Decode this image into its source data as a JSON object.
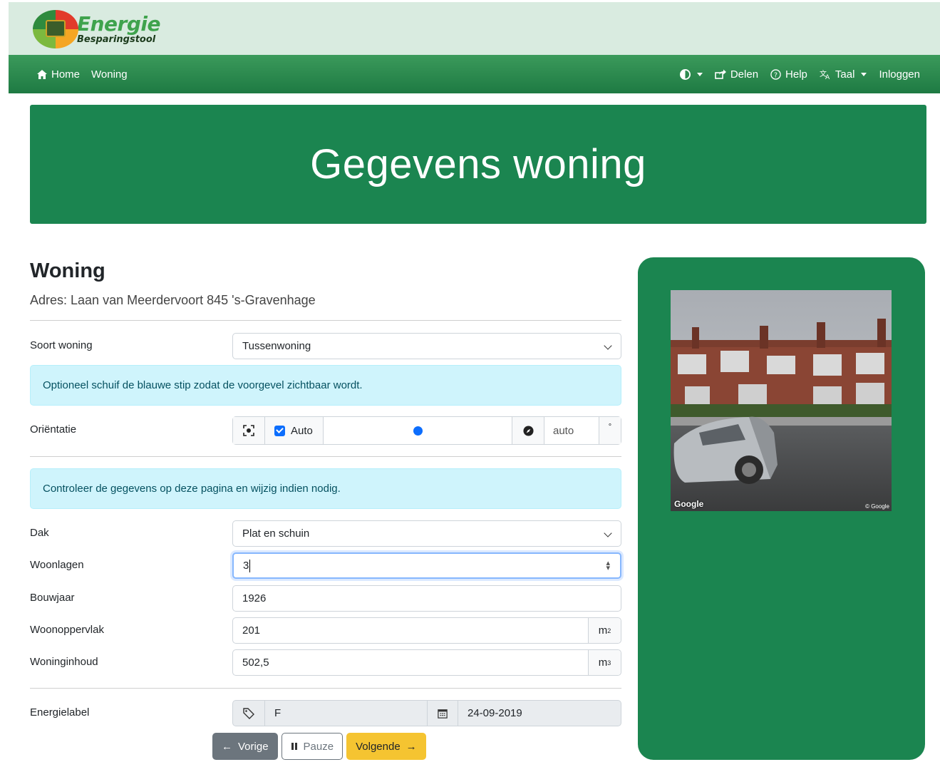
{
  "header": {
    "logo_word1": "Energie",
    "logo_word2": "Besparingstool"
  },
  "nav": {
    "home": "Home",
    "woning": "Woning",
    "theme": "",
    "share": "Delen",
    "help": "Help",
    "language": "Taal",
    "login": "Inloggen"
  },
  "hero": {
    "title": "Gegevens woning"
  },
  "section": {
    "title": "Woning",
    "address": "Adres: Laan van Meerdervoort 845 's-Gravenhage"
  },
  "form": {
    "soort_woning": {
      "label": "Soort woning",
      "value": "Tussenwoning"
    },
    "alert_orientation": "Optioneel schuif de blauwe stip zodat de voorgevel zichtbaar wordt.",
    "orientatie": {
      "label": "Oriëntatie",
      "auto_label": "Auto",
      "auto_checked": true,
      "value": "auto",
      "unit": "°"
    },
    "alert_check": "Controleer de gegevens op deze pagina en wijzig indien nodig.",
    "dak": {
      "label": "Dak",
      "value": "Plat en schuin"
    },
    "woonlagen": {
      "label": "Woonlagen",
      "value": "3"
    },
    "bouwjaar": {
      "label": "Bouwjaar",
      "value": "1926"
    },
    "woonoppervlak": {
      "label": "Woonoppervlak",
      "value": "201",
      "unit": "m",
      "unit_exp": "2"
    },
    "woninginhoud": {
      "label": "Woninginhoud",
      "value": "502,5",
      "unit": "m",
      "unit_exp": "3"
    },
    "energielabel": {
      "label": "Energielabel",
      "value": "F",
      "date": "24-09-2019"
    }
  },
  "buttons": {
    "prev": "Vorige",
    "pause": "Pauze",
    "next": "Volgende"
  },
  "streetview": {
    "attribution": "Google",
    "copyright": "© Google"
  },
  "colors": {
    "brand_green": "#1b8550",
    "nav_green": "#2d8c50",
    "topbar": "#d9ebe0",
    "accent_yellow": "#f5c431",
    "alert_bg": "#cff4fc",
    "primary_blue": "#0d6efd"
  }
}
